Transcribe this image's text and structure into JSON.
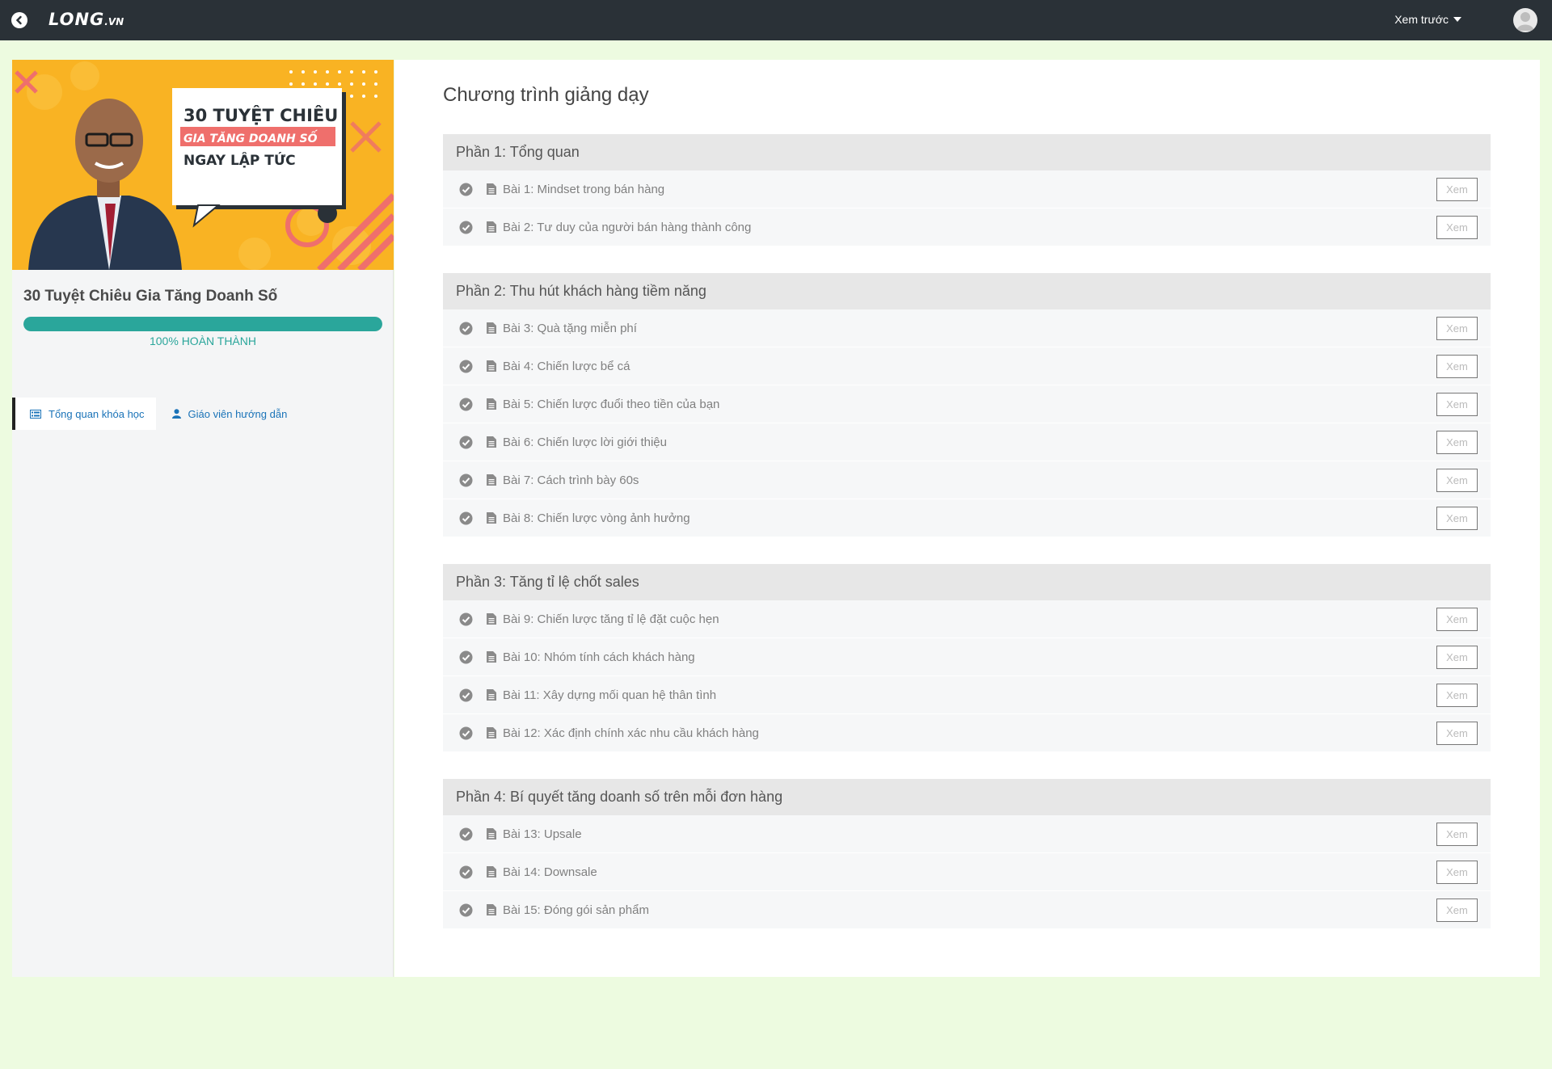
{
  "header": {
    "logo_text": "LONG",
    "logo_suffix": ".VN",
    "preview_label": "Xem trước"
  },
  "sidebar": {
    "banner": {
      "line1": "30 TUYỆT CHIÊU",
      "line2": "GIA TĂNG DOANH SỐ",
      "line3": "NGAY LẬP TỨC"
    },
    "course_title": "30 Tuyệt Chiêu Gia Tăng Doanh Số",
    "progress": {
      "percent": 100,
      "percent_label": "100%",
      "status_label": "HOÀN THÀNH"
    },
    "tabs": [
      {
        "label": "Tổng quan khóa học",
        "icon": "course-overview-icon"
      },
      {
        "label": "Giáo viên hướng dẫn",
        "icon": "user-icon"
      }
    ]
  },
  "main": {
    "title": "Chương trình giảng dạy",
    "view_label": "Xem",
    "sections": [
      {
        "title": "Phần 1: Tổng quan",
        "lessons": [
          "Bài 1: Mindset trong bán hàng",
          "Bài 2: Tư duy của người bán hàng thành công"
        ]
      },
      {
        "title": "Phần 2: Thu hút khách hàng tiềm năng",
        "lessons": [
          "Bài 3: Quà tặng miễn phí",
          "Bài 4: Chiến lược bể cá",
          "Bài 5: Chiến lược đuổi theo tiền của bạn",
          "Bài 6: Chiến lược lời giới thiệu",
          "Bài 7: Cách trình bày 60s",
          "Bài 8: Chiến lược vòng ảnh hưởng"
        ]
      },
      {
        "title": "Phần 3: Tăng tỉ lệ chốt sales",
        "lessons": [
          "Bài 9: Chiến lược tăng tỉ lệ đặt cuộc hẹn",
          "Bài 10: Nhóm tính cách khách hàng",
          "Bài 11: Xây dựng mối quan hệ thân tình",
          "Bài 12: Xác định chính xác nhu cầu khách hàng"
        ]
      },
      {
        "title": "Phần 4: Bí quyết tăng doanh số trên mỗi đơn hàng",
        "lessons": [
          "Bài 13: Upsale",
          "Bài 14: Downsale",
          "Bài 15: Đóng gói sản phẩm"
        ]
      }
    ]
  }
}
